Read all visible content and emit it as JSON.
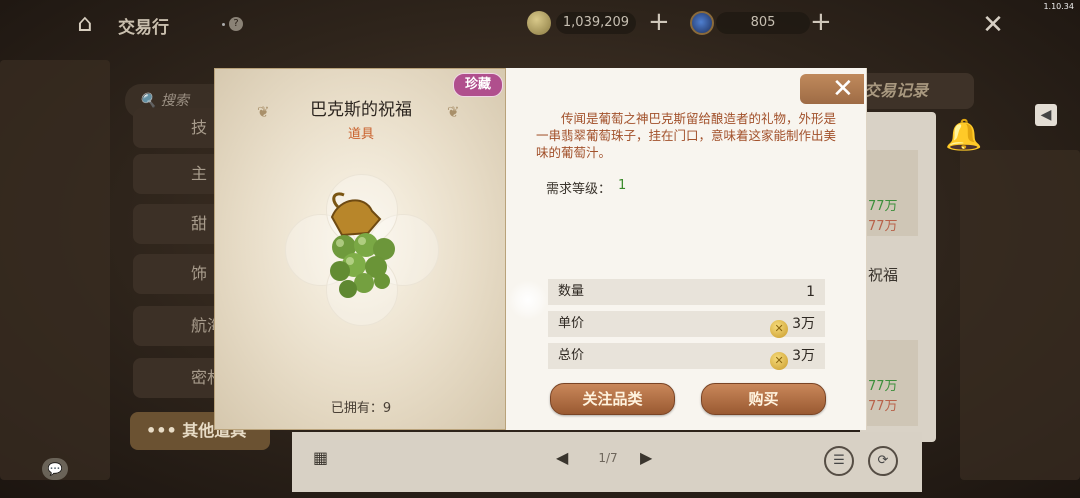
{
  "version": "1.10.34",
  "top_bar": {
    "title": "交易行",
    "help": "?",
    "gold": "1,039,209",
    "gems": "805",
    "plus": "+"
  },
  "side_menu": {
    "search_placeholder": "搜索",
    "items": [
      "技",
      "主",
      "甜",
      "饰",
      "航海",
      "密林"
    ],
    "active": "••• 其他道具"
  },
  "trade_record_tab": "交易记录",
  "background_prices": {
    "p1": "77万",
    "p2": "77万",
    "p3": "77万",
    "p4": "77万",
    "name_fragment": "祝福"
  },
  "pagination": {
    "page": "1/7",
    "prev": "◀",
    "next": "▶"
  },
  "dialog": {
    "badge": "珍藏",
    "item_name": "巴克斯的祝福",
    "item_type": "道具",
    "owned": "已拥有：9",
    "description": "传闻是葡萄之神巴克斯留给酿造者的礼物，外形是一串翡翠葡萄珠子，挂在门口，意味着这家能制作出美味的葡萄汁。",
    "level_label": "需求等级：",
    "level_value": "1",
    "rows": [
      {
        "label": "数量",
        "value": "1"
      },
      {
        "label": "单价",
        "value": "3万"
      },
      {
        "label": "总价",
        "value": "3万"
      }
    ],
    "follow_button": "关注品类",
    "buy_button": "购买"
  },
  "colors": {
    "rare_badge": "#b04f8d",
    "description_text": "#a2512b",
    "level_value": "#3a8a2a",
    "button": "#b06e44"
  },
  "icons": [
    "home-icon",
    "gold-coin-icon",
    "gem-icon",
    "close-icon",
    "search-icon",
    "chat-icon",
    "bell-icon",
    "grid-icon",
    "sort-icon",
    "refresh-icon",
    "grapes-item-icon"
  ]
}
